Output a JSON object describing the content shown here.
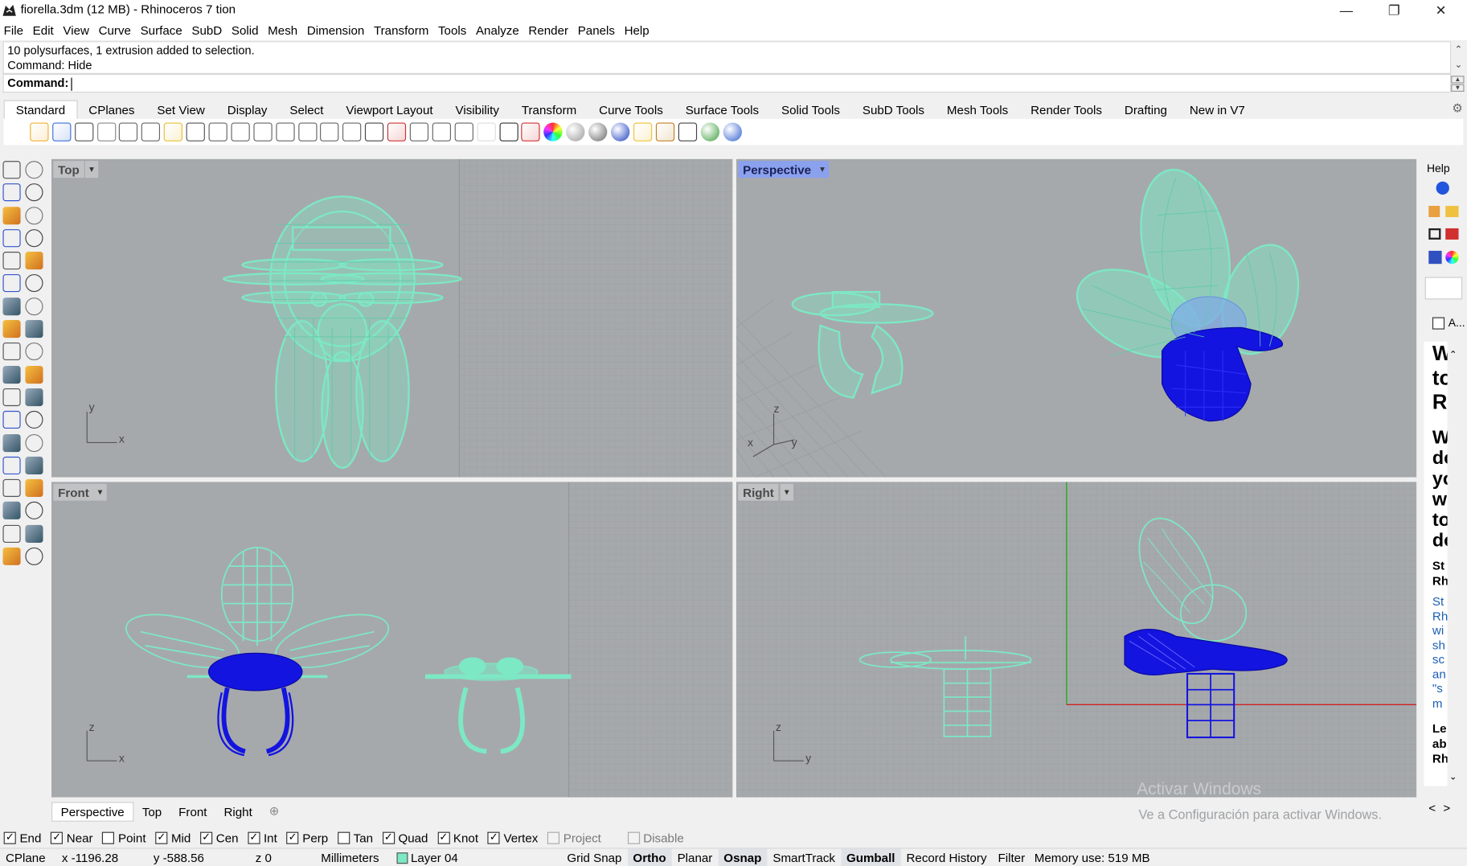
{
  "window": {
    "title": "fiorella.3dm (12 MB) - Rhinoceros 7 tion",
    "minimize_glyph": "—",
    "restore_glyph": "❐",
    "close_glyph": "✕"
  },
  "menu": [
    "File",
    "Edit",
    "View",
    "Curve",
    "Surface",
    "SubD",
    "Solid",
    "Mesh",
    "Dimension",
    "Transform",
    "Tools",
    "Analyze",
    "Render",
    "Panels",
    "Help"
  ],
  "command": {
    "history": [
      "10 polysurfaces, 1 extrusion added to selection.",
      "Command: Hide"
    ],
    "prompt": "Command:"
  },
  "toolbar_tabs": [
    "Standard",
    "CPlanes",
    "Set View",
    "Display",
    "Select",
    "Viewport Layout",
    "Visibility",
    "Transform",
    "Curve Tools",
    "Surface Tools",
    "Solid Tools",
    "SubD Tools",
    "Mesh Tools",
    "Render Tools",
    "Drafting",
    "New in V7"
  ],
  "toolbar_icons": [
    "new-icon",
    "open-icon",
    "save-icon",
    "print-icon",
    "import-icon",
    "cut-icon",
    "copy-icon",
    "paste-icon",
    "undo-icon",
    "pan-icon",
    "move-view-icon",
    "zoom-icon",
    "zoom-window-icon",
    "zoom-extents-icon",
    "zoom-selected-icon",
    "rotate-view-icon",
    "four-viewports-icon",
    "car-icon",
    "named-views-icon",
    "cplane-icon",
    "set-view-icon",
    "light-icon",
    "lock-icon",
    "materials-icon",
    "color-wheel-icon",
    "wireframe-sphere-icon",
    "shaded-sphere-icon",
    "rendered-sphere-icon",
    "filter-icon",
    "settings-gears-icon",
    "snap-grid-icon",
    "render-globe-icon",
    "help-icon"
  ],
  "left_tools": [
    "select-icon",
    "point-icon",
    "polyline-icon",
    "curve-icon",
    "circle-icon",
    "ellipse-icon",
    "arc-icon",
    "rectangle-icon",
    "polygon-icon",
    "fillet-icon",
    "surface-icon",
    "loft-icon",
    "box-icon",
    "solid-union-icon",
    "extrude-icon",
    "mesh-icon",
    "explode-icon",
    "boolean-icon",
    "move-icon",
    "align-icon",
    "sweep-icon",
    "join-icon",
    "curve-edit-icon",
    "rebuild-icon",
    "text-icon",
    "dimension-icon",
    "block-icon",
    "group-icon",
    "analyze-icon",
    "layout-icon",
    "array-icon",
    "transform-icon",
    "shaded-icon",
    "check-icon",
    "render-icon",
    "material-icon"
  ],
  "viewports": {
    "top": {
      "label": "Top",
      "axis_a": "y",
      "axis_b": "x"
    },
    "perspective": {
      "label": "Perspective",
      "axis_a": "z",
      "axis_b": "y",
      "axis_c": "x"
    },
    "front": {
      "label": "Front",
      "axis_a": "z",
      "axis_b": "x"
    },
    "right": {
      "label": "Right",
      "axis_a": "z",
      "axis_b": "y"
    },
    "menu_arrow": "▾"
  },
  "viewport_tabs": [
    "Perspective",
    "Top",
    "Front",
    "Right"
  ],
  "add_tab_glyph": "⊕",
  "osnap": [
    {
      "label": "End",
      "checked": true
    },
    {
      "label": "Near",
      "checked": true
    },
    {
      "label": "Point",
      "checked": false
    },
    {
      "label": "Mid",
      "checked": true
    },
    {
      "label": "Cen",
      "checked": true
    },
    {
      "label": "Int",
      "checked": true
    },
    {
      "label": "Perp",
      "checked": true
    },
    {
      "label": "Tan",
      "checked": false
    },
    {
      "label": "Quad",
      "checked": true
    },
    {
      "label": "Knot",
      "checked": true
    },
    {
      "label": "Vertex",
      "checked": true
    },
    {
      "label": "Project",
      "checked": false,
      "disabled": true
    },
    {
      "label": "Disable",
      "checked": false,
      "disabled": true
    }
  ],
  "status": {
    "cplane": "CPlane",
    "x": "x -1196.28",
    "y": "y -588.56",
    "z": "z 0",
    "units": "Millimeters",
    "layer": "Layer 04",
    "layer_color": "#7de8c4",
    "toggles": [
      {
        "label": "Grid Snap",
        "bold": false
      },
      {
        "label": "Ortho",
        "bold": true
      },
      {
        "label": "Planar",
        "bold": false
      },
      {
        "label": "Osnap",
        "bold": true
      },
      {
        "label": "SmartTrack",
        "bold": false
      },
      {
        "label": "Gumball",
        "bold": true
      },
      {
        "label": "Record History",
        "bold": false
      },
      {
        "label": "Filter",
        "bold": false
      }
    ],
    "memory": "Memory use: 519 MB"
  },
  "right_panel": {
    "title": "Help",
    "checkbox_label": "A...",
    "doc_lines": [
      "W",
      "to",
      "R",
      "",
      "W",
      "do",
      "yo",
      "w",
      "to",
      "do",
      "St",
      "Rh",
      "St",
      "Rh",
      "wi",
      "sh",
      "sc",
      "an",
      "\"s",
      "m",
      "Le",
      "ab",
      "Rh"
    ],
    "nav_back": "<",
    "nav_fwd": ">"
  },
  "watermark": {
    "line1": "Activar Windows",
    "line2": "Ve a Configuración para activar Windows."
  },
  "colors": {
    "wire_mint": "#7de8c4",
    "wire_blue": "#1414e0",
    "viewport_bg": "#a6a9ac",
    "active_label": "#8aa1ee"
  }
}
